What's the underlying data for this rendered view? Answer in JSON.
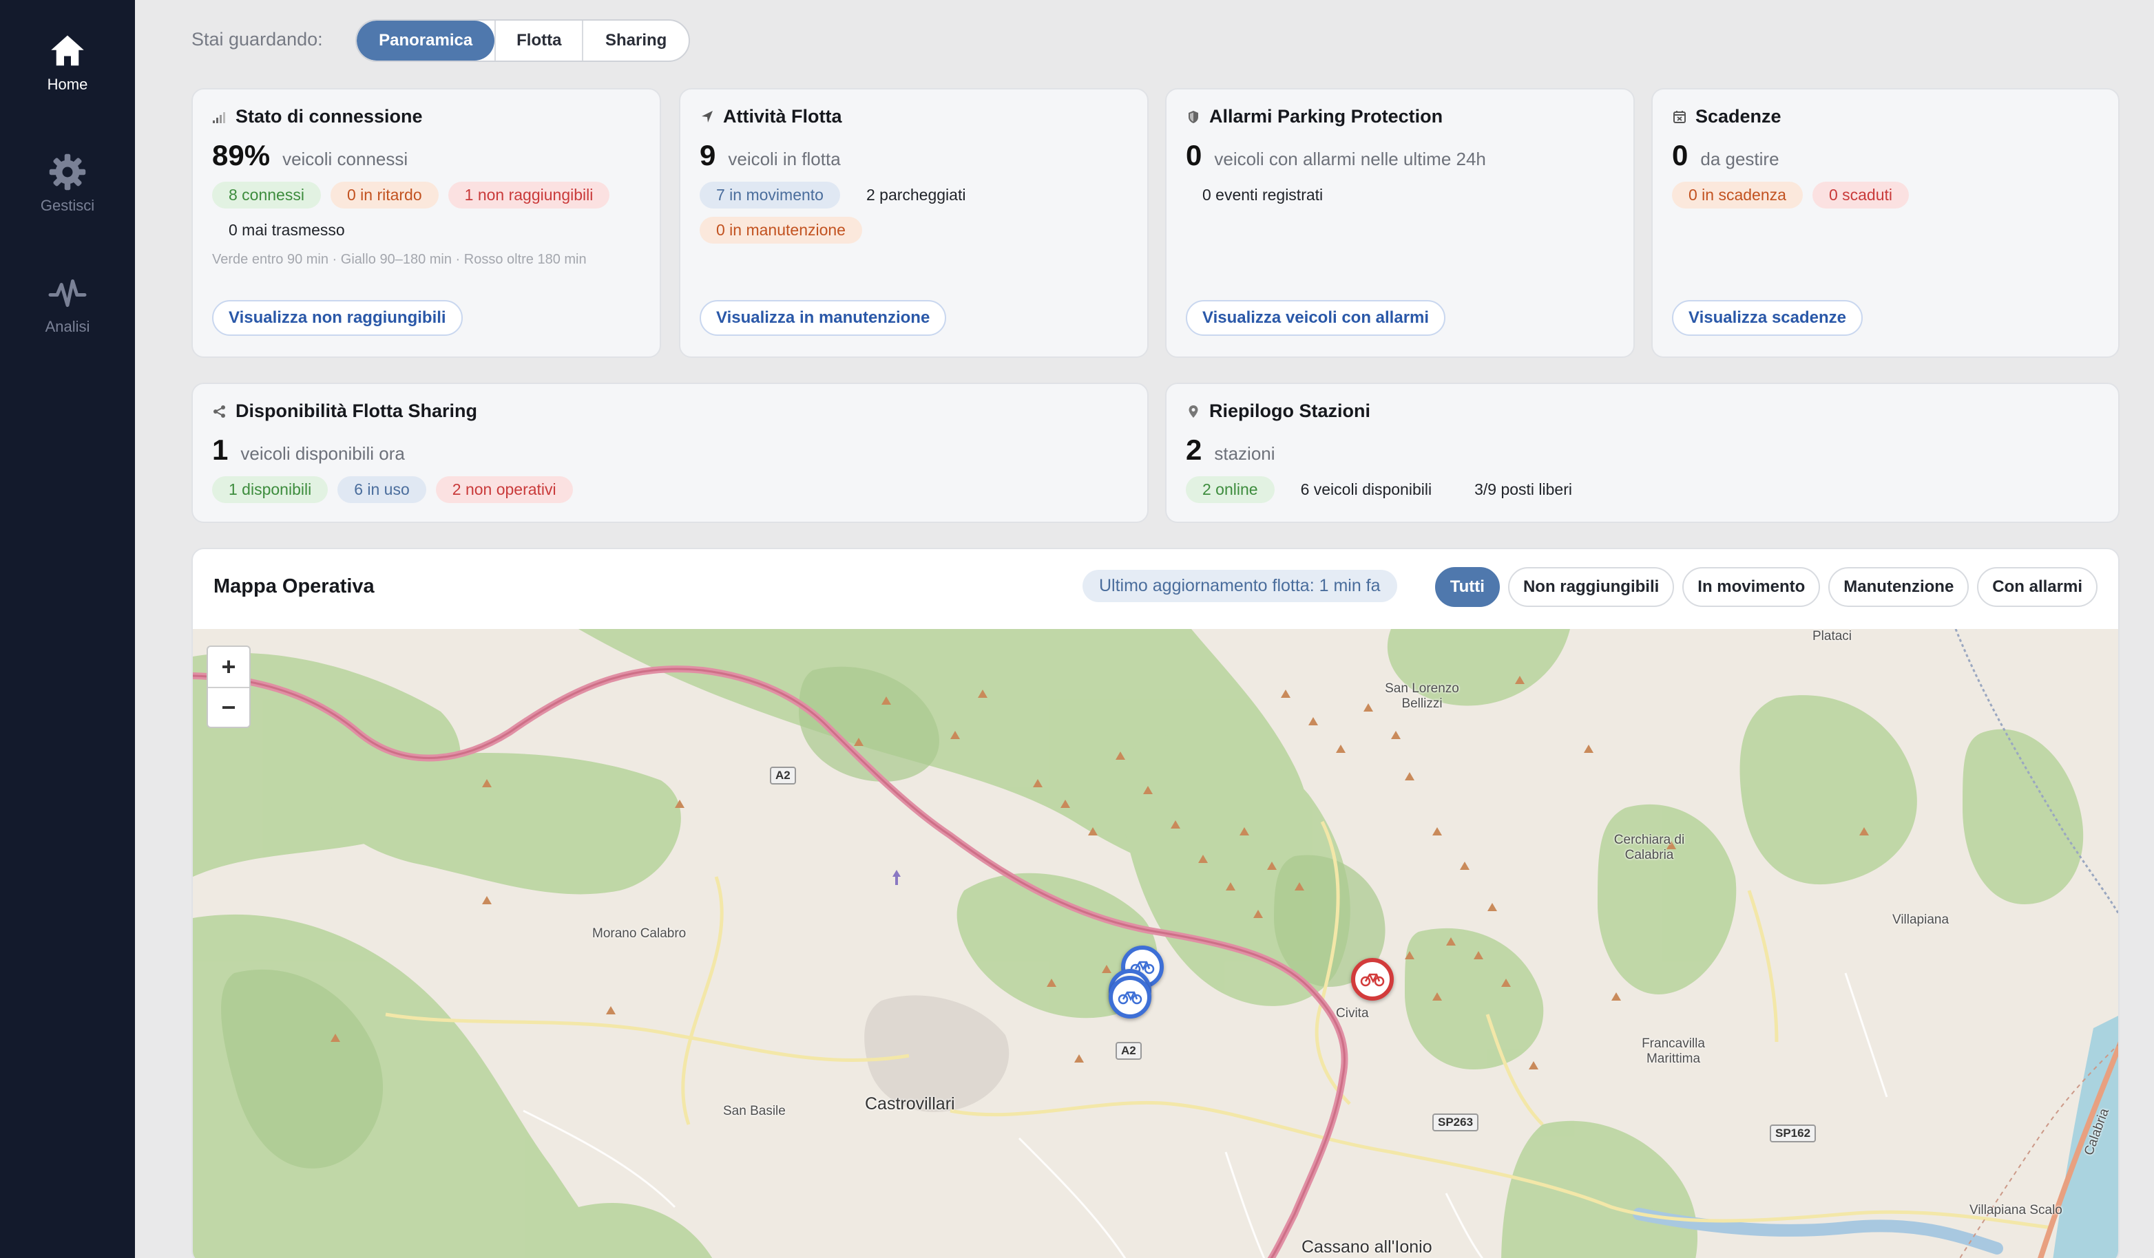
{
  "sidebar": {
    "items": [
      {
        "label": "Home",
        "icon": "home-icon",
        "active": true
      },
      {
        "label": "Gestisci",
        "icon": "gear-icon",
        "active": false
      },
      {
        "label": "Analisi",
        "icon": "activity-icon",
        "active": false
      }
    ]
  },
  "view_switcher": {
    "label": "Stai guardando:",
    "options": [
      "Panoramica",
      "Flotta",
      "Sharing"
    ],
    "selected": "Panoramica"
  },
  "cards": {
    "connection": {
      "title": "Stato di connessione",
      "icon": "signal-icon",
      "value": "89%",
      "value_label": "veicoli connessi",
      "chips": [
        "8 connessi",
        "0 in ritardo",
        "1 non raggiungibili",
        "0 mai trasmesso"
      ],
      "hint": "Verde entro 90 min · Giallo 90–180 min · Rosso oltre 180 min",
      "action": "Visualizza non raggiungibili"
    },
    "fleet": {
      "title": "Attività Flotta",
      "icon": "navigation-icon",
      "value": "9",
      "value_label": "veicoli in flotta",
      "chips": [
        "7 in movimento",
        "2 parcheggiati",
        "0 in manutenzione"
      ],
      "action": "Visualizza in manutenzione"
    },
    "alarms": {
      "title": "Allarmi Parking Protection",
      "icon": "shield-icon",
      "value": "0",
      "value_label": "veicoli con allarmi nelle ultime 24h",
      "chips": [
        "0 eventi registrati"
      ],
      "action": "Visualizza veicoli con allarmi"
    },
    "deadlines": {
      "title": "Scadenze",
      "icon": "calendar-x-icon",
      "value": "0",
      "value_label": "da gestire",
      "chips": [
        "0 in scadenza",
        "0 scaduti"
      ],
      "action": "Visualizza scadenze"
    },
    "sharing": {
      "title": "Disponibilità Flotta Sharing",
      "icon": "share-icon",
      "value": "1",
      "value_label": "veicoli disponibili ora",
      "chips": [
        "1 disponibili",
        "6 in uso",
        "2 non operativi"
      ]
    },
    "stations": {
      "title": "Riepilogo Stazioni",
      "icon": "map-pin-icon",
      "value": "2",
      "value_label": "stazioni",
      "chips": [
        "2 online",
        "6 veicoli disponibili",
        "3/9 posti liberi"
      ]
    }
  },
  "map": {
    "title": "Mappa Operativa",
    "last_update": "Ultimo aggiornamento flotta: 1 min fa",
    "filters": [
      "Tutti",
      "Non raggiungibili",
      "In movimento",
      "Manutenzione",
      "Con allarmi"
    ],
    "selected_filter": "Tutti",
    "zoom_in": "+",
    "zoom_out": "−",
    "places": [
      "Castrovillari",
      "Morano Calabro",
      "San Basile",
      "Civita",
      "Cassano all'Ionio",
      "Francavilla Marittima",
      "Cerchiara di Calabria",
      "San Lorenzo Bellizzi",
      "Villapiana",
      "Villapiana Scalo",
      "Plataci",
      "Calabria"
    ],
    "roads": [
      "A2",
      "A2",
      "SP263",
      "SP162"
    ],
    "markers": [
      {
        "type": "bike",
        "status": "ok",
        "color": "#3d6fd6"
      },
      {
        "type": "bike",
        "status": "ok",
        "color": "#3d6fd6"
      },
      {
        "type": "bike",
        "status": "ok",
        "color": "#3d6fd6"
      },
      {
        "type": "bike",
        "status": "unreachable",
        "color": "#d23b3b"
      }
    ]
  },
  "colors": {
    "sidebar_bg": "#131a2c",
    "accent": "#4f78ad",
    "link": "#2a58a8"
  }
}
